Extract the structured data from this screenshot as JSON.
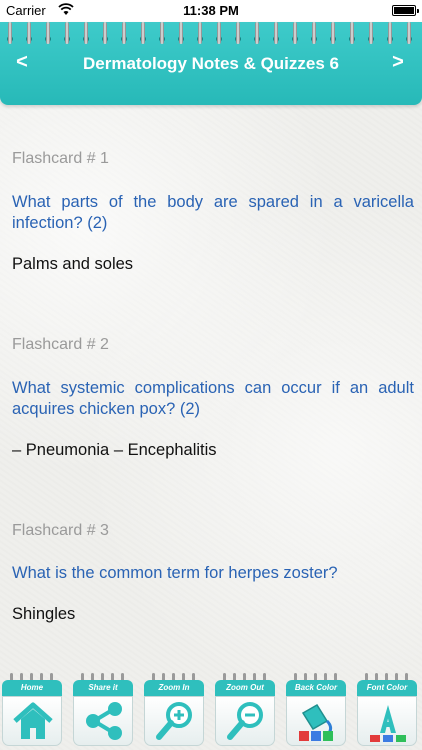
{
  "status_bar": {
    "carrier": "Carrier",
    "time": "11:38 PM",
    "battery_level": 1.0
  },
  "header": {
    "title": "Dermatology Notes & Quizzes 6",
    "prev_label": "<",
    "next_label": ">",
    "accent_color": "#2fbfbd"
  },
  "flashcards": [
    {
      "label": "Flashcard # 1",
      "question": "What parts of the body are spared in a varicella infection? (2)",
      "answer": "Palms and soles"
    },
    {
      "label": "Flashcard # 2",
      "question": "What systemic complications can occur if an adult acquires chicken pox? (2)",
      "answer": "– Pneumonia – Encephalitis"
    },
    {
      "label": "Flashcard # 3",
      "question": "What is the common term for herpes zoster?",
      "answer": "Shingles"
    }
  ],
  "toolbar": {
    "items": [
      {
        "label": "Home",
        "icon": "home-icon"
      },
      {
        "label": "Share it",
        "icon": "share-icon"
      },
      {
        "label": "Zoom In",
        "icon": "zoom-in-icon"
      },
      {
        "label": "Zoom Out",
        "icon": "zoom-out-icon"
      },
      {
        "label": "Back Color",
        "icon": "paint-bucket-icon"
      },
      {
        "label": "Font Color",
        "icon": "font-color-icon"
      }
    ]
  },
  "colors": {
    "question_text": "#2a63b4",
    "label_text": "#9a9a9a",
    "answer_text": "#111111"
  }
}
